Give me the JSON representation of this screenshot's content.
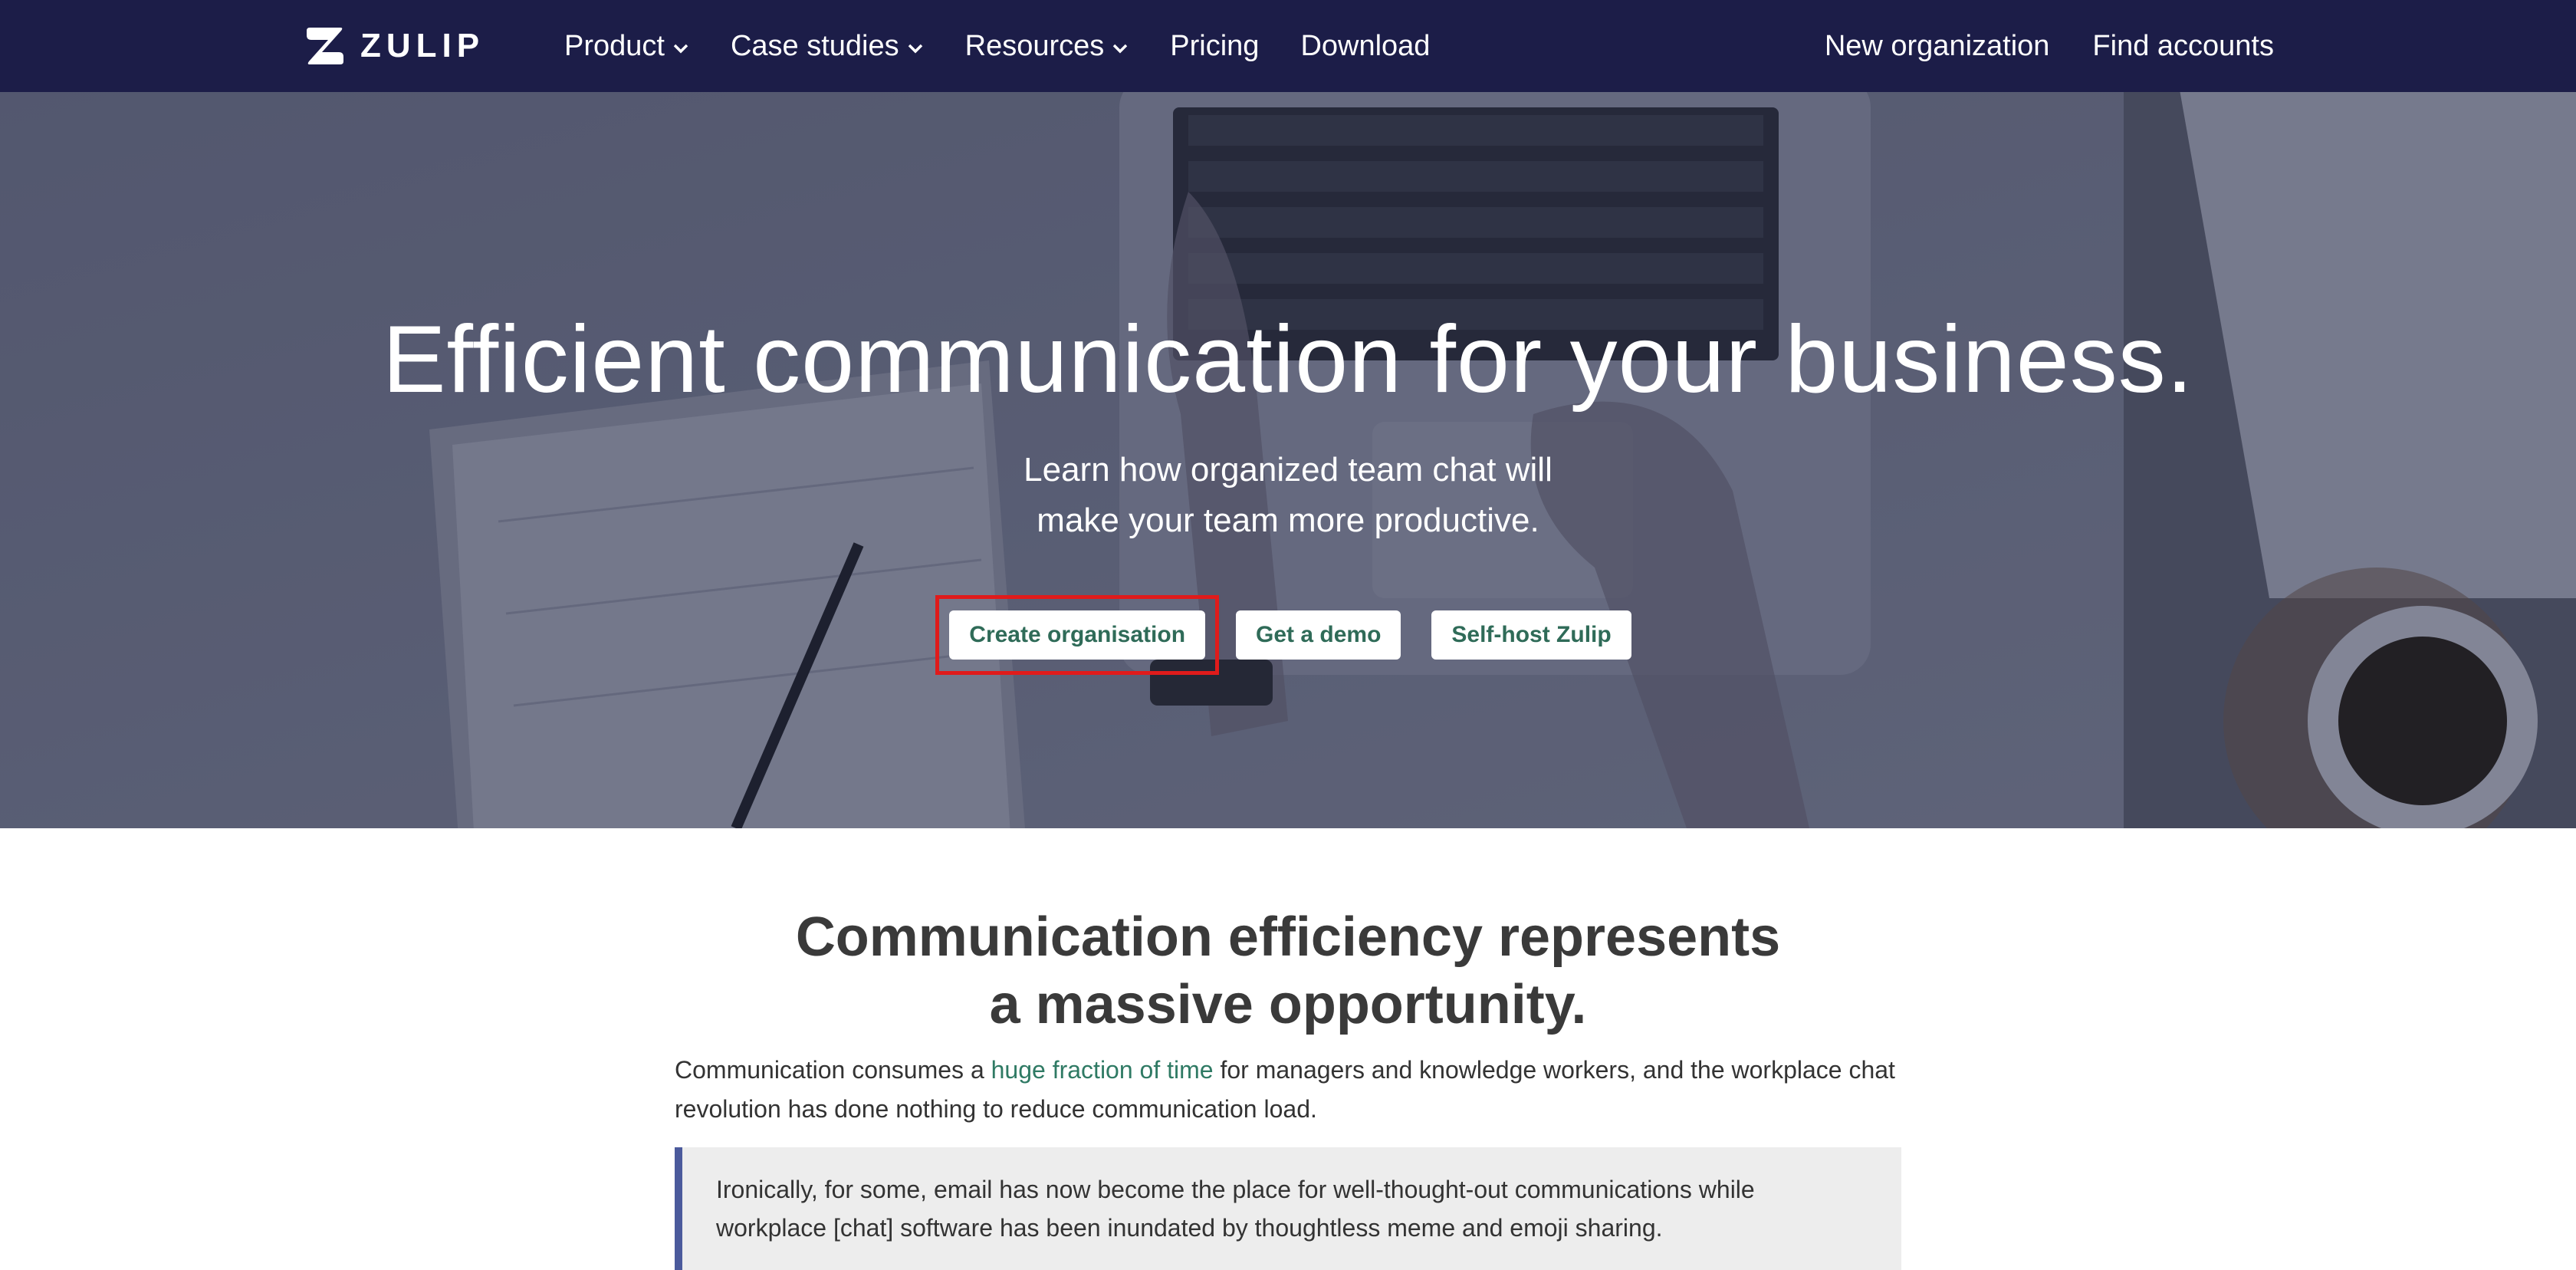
{
  "brand": {
    "name": "ZULIP"
  },
  "nav": {
    "left": [
      {
        "label": "Product",
        "dropdown": true
      },
      {
        "label": "Case studies",
        "dropdown": true
      },
      {
        "label": "Resources",
        "dropdown": true
      },
      {
        "label": "Pricing",
        "dropdown": false
      },
      {
        "label": "Download",
        "dropdown": false
      }
    ],
    "right": [
      {
        "label": "New organization"
      },
      {
        "label": "Find accounts"
      }
    ]
  },
  "hero": {
    "title": "Efficient communication for your business.",
    "subtitle_line1": "Learn how organized team chat will",
    "subtitle_line2": "make your team more productive.",
    "buttons": {
      "create": "Create organisation",
      "demo": "Get a demo",
      "selfhost": "Self-host Zulip"
    }
  },
  "section": {
    "title_line1": "Communication efficiency represents",
    "title_line2": "a massive opportunity.",
    "para_before": "Communication consumes a ",
    "para_link": "huge fraction of time",
    "para_after": " for managers and knowledge workers, and the workplace chat revolution has done nothing to reduce communication load.",
    "quote": "Ironically, for some, email has now become the place for well-thought-out communications while workplace [chat] software has been inundated by thoughtless meme and emoji sharing."
  },
  "colors": {
    "navbar": "#1c1d48",
    "button_text": "#2f6b58",
    "link": "#2f7a64",
    "quote_border": "#4b5a9c",
    "highlight": "#e01b1b"
  }
}
